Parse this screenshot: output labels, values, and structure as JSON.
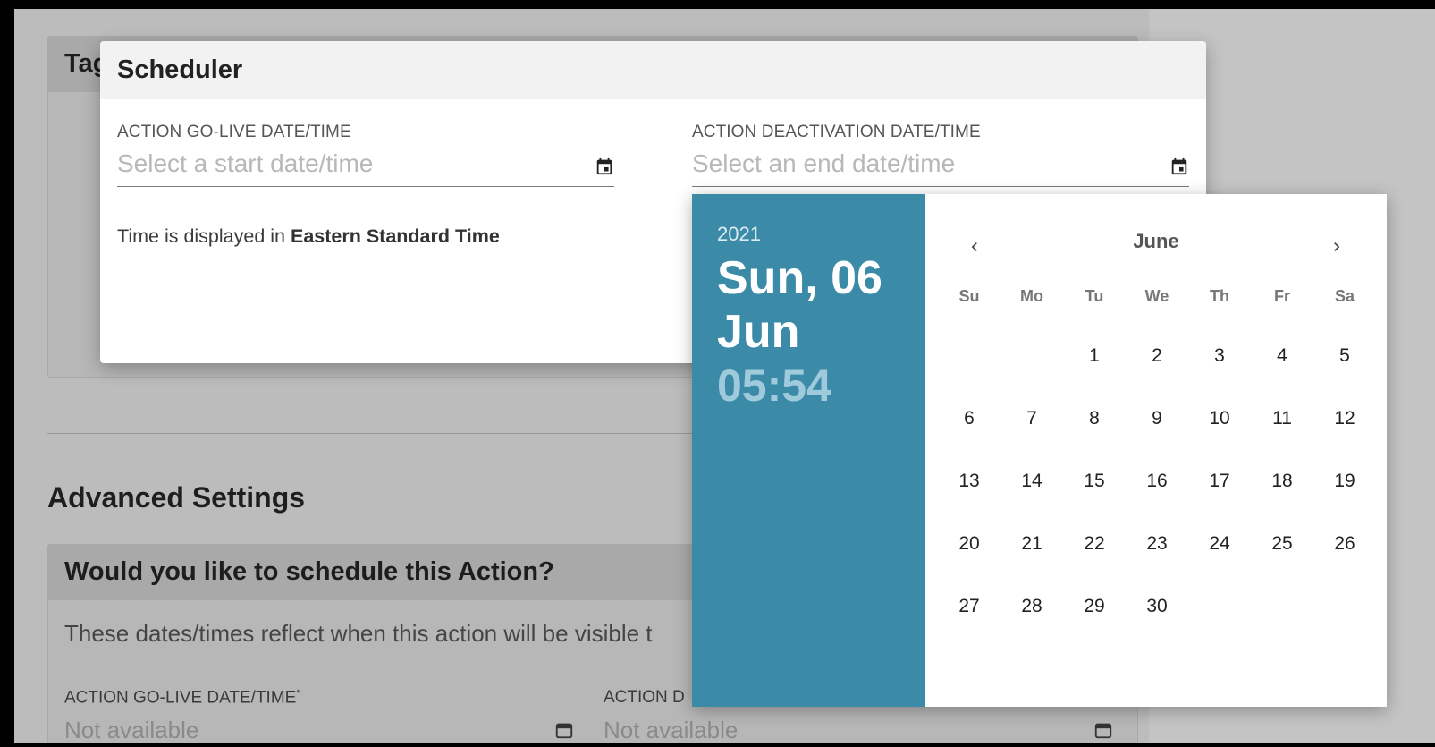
{
  "background": {
    "card_title": "Tag",
    "advanced_title": "Advanced Settings",
    "schedule_question": "Would you like to schedule this Action?",
    "schedule_description": "These dates/times reflect when this action will be visible t",
    "golive_label": "ACTION GO-LIVE DATE/TIME",
    "golive_required": "*",
    "golive_value": "Not available",
    "deact_label": "ACTION D",
    "deact_value": "Not available"
  },
  "dialog": {
    "title": "Scheduler",
    "start_field": {
      "label": "ACTION GO-LIVE DATE/TIME",
      "placeholder": "Select a start date/time",
      "icon": "calendar-icon"
    },
    "end_field": {
      "label": "ACTION DEACTIVATION DATE/TIME",
      "placeholder": "Select an end date/time",
      "icon": "calendar-icon"
    },
    "timezone_prefix": "Time is displayed in ",
    "timezone_name": "Eastern Standard Time"
  },
  "picker": {
    "year": "2021",
    "date_line1": "Sun, 06",
    "date_line2": "Jun",
    "time": "05:54",
    "month": "June",
    "prev_icon": "chevron-left-icon",
    "next_icon": "chevron-right-icon",
    "weekdays": [
      "Su",
      "Mo",
      "Tu",
      "We",
      "Th",
      "Fr",
      "Sa"
    ],
    "days": [
      "",
      "",
      "1",
      "2",
      "3",
      "4",
      "5",
      "6",
      "7",
      "8",
      "9",
      "10",
      "11",
      "12",
      "13",
      "14",
      "15",
      "16",
      "17",
      "18",
      "19",
      "20",
      "21",
      "22",
      "23",
      "24",
      "25",
      "26",
      "27",
      "28",
      "29",
      "30",
      "",
      "",
      ""
    ],
    "accent_color": "#3b8ba8"
  }
}
